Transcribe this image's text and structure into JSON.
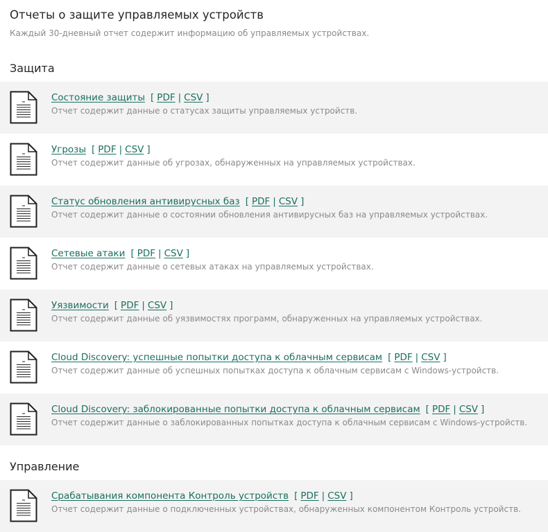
{
  "page": {
    "title": "Отчеты о защите управляемых устройств",
    "subtitle": "Каждый 30-дневный отчет содержит информацию об управляемых устройствах."
  },
  "icon": "document-icon",
  "colors": {
    "link": "#1a6f5e",
    "row_shade": "#f3f3f3",
    "muted_text": "#8a8a8a"
  },
  "sections": [
    {
      "title": "Защита",
      "reports": [
        {
          "name": "Состояние защиты",
          "pdf": "PDF",
          "csv": "CSV",
          "description": "Отчет содержит данные о статусах защиты управляемых устройств."
        },
        {
          "name": "Угрозы",
          "pdf": "PDF",
          "csv": "CSV",
          "description": "Отчет содержит данные об угрозах, обнаруженных на управляемых устройствах."
        },
        {
          "name": "Статус обновления антивирусных баз",
          "pdf": "PDF",
          "csv": "CSV",
          "description": "Отчет содержит данные о состоянии обновления антивирусных баз на управляемых устройствах."
        },
        {
          "name": "Сетевые атаки",
          "pdf": "PDF",
          "csv": "CSV",
          "description": "Отчет содержит данные о сетевых атаках на управляемых устройствах."
        },
        {
          "name": "Уязвимости",
          "pdf": "PDF",
          "csv": "CSV",
          "description": "Отчет содержит данные об уязвимостях программ, обнаруженных на управляемых устройствах."
        },
        {
          "name": "Cloud Discovery: успешные попытки доступа к облачным сервисам",
          "pdf": "PDF",
          "csv": "CSV",
          "description": "Отчет содержит данные об успешных попытках доступа к облачным сервисам с Windows-устройств."
        },
        {
          "name": "Cloud Discovery: заблокированные попытки доступа к облачным сервисам",
          "pdf": "PDF",
          "csv": "CSV",
          "description": "Отчет содержит данные о заблокированных попытках доступа к облачным сервисам с Windows-устройств."
        }
      ]
    },
    {
      "title": "Управление",
      "reports": [
        {
          "name": "Срабатывания компонента Контроль устройств",
          "pdf": "PDF",
          "csv": "CSV",
          "description": "Отчет содержит данные о подключенных устройствах, обнаруженных компонентом Контроль устройств."
        }
      ]
    }
  ]
}
